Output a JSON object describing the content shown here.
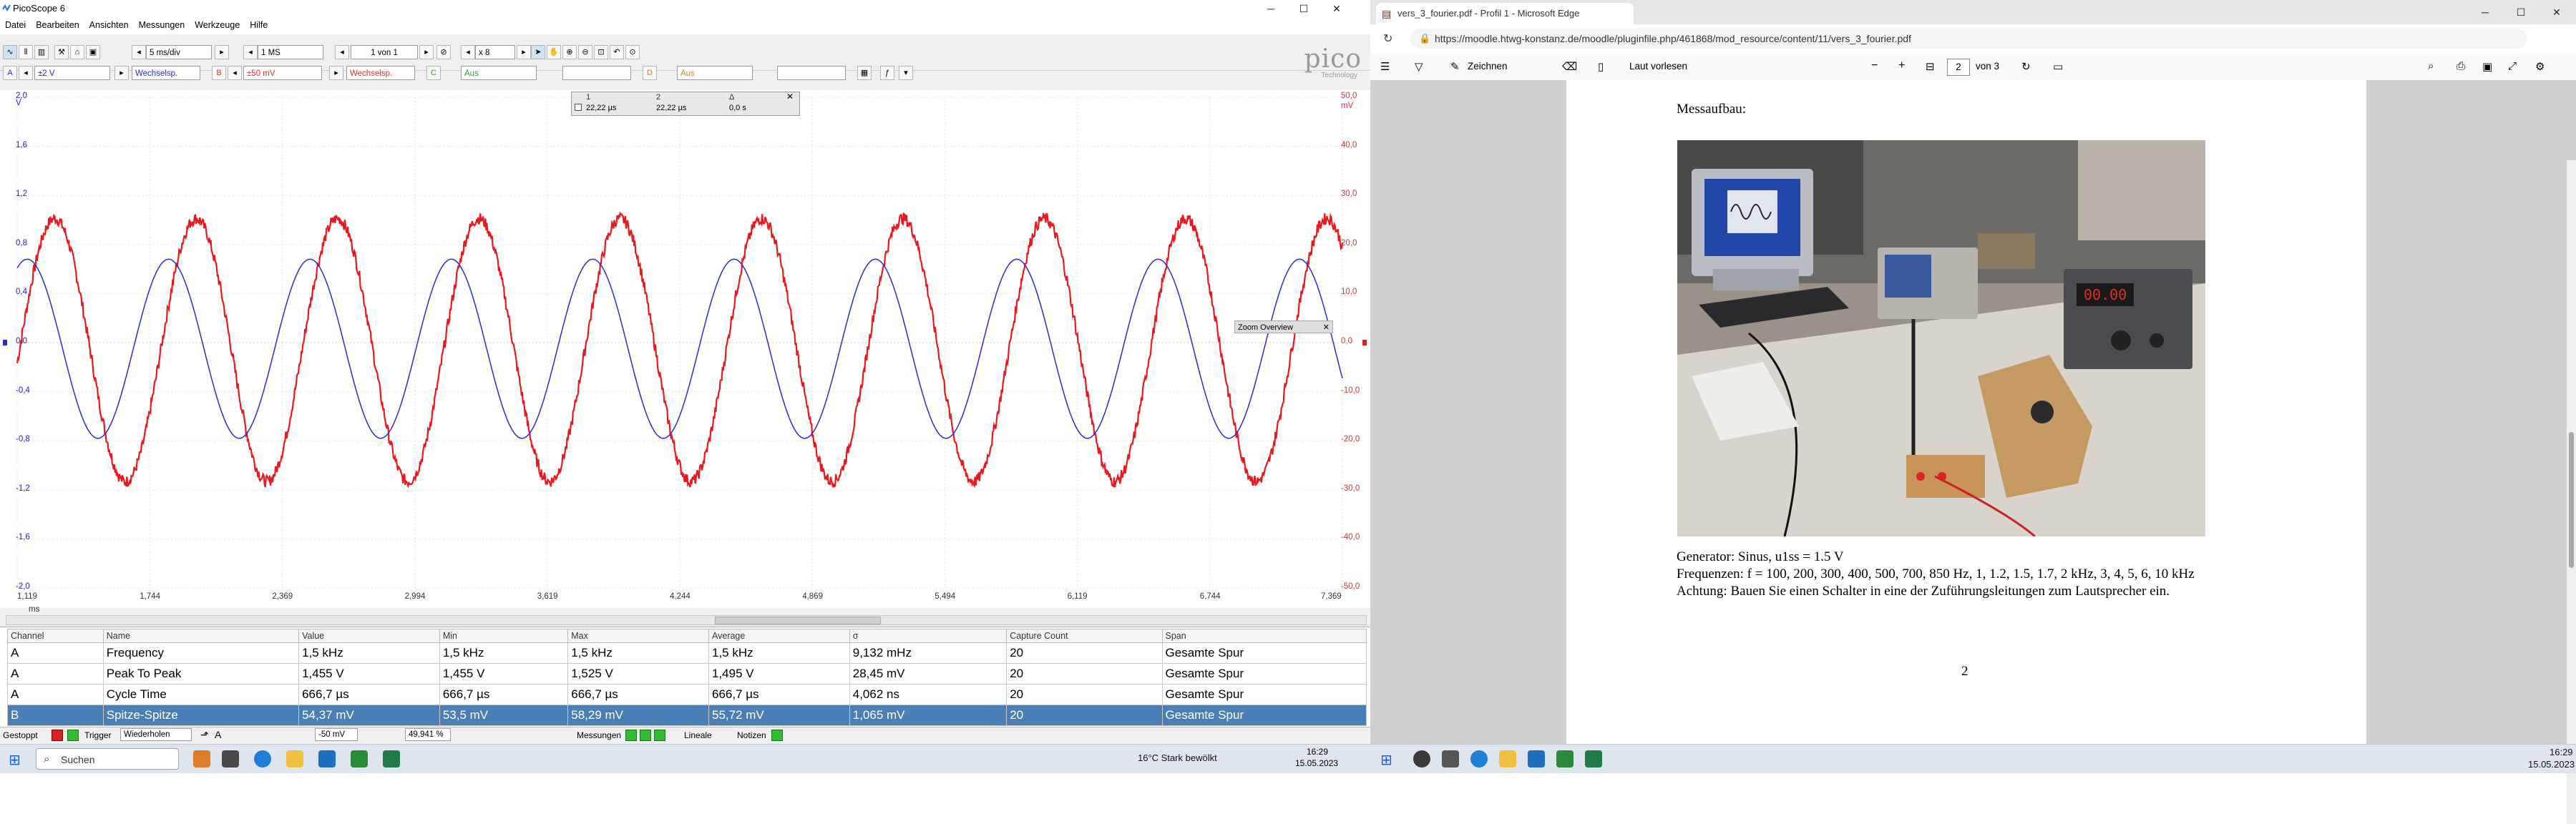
{
  "pico": {
    "title": "PicoScope 6",
    "menus": [
      "Datei",
      "Bearbeiten",
      "Ansichten",
      "Messungen",
      "Werkzeuge",
      "Hilfe"
    ],
    "toolbar": {
      "timebase": "5 ms/div",
      "samples": "1 MS",
      "capture_index": "1 von 1",
      "zoom": "x 8",
      "chA_range": "±2 V",
      "chA_coupling": "Wechselsp.",
      "chB_range": "±50 mV",
      "chB_coupling": "Wechselsp.",
      "chC_label": "Aus",
      "chD_label": "Aus"
    },
    "logo": "pico",
    "logo_sub": "Technology",
    "axes": {
      "left_unit": "V",
      "right_unit": "mV",
      "x_unit": "ms",
      "left_ticks": [
        "2,0",
        "1,6",
        "1,2",
        "0,8",
        "0,4",
        "0,0",
        "-0,4",
        "-0,8",
        "-1,2",
        "-1,6",
        "-2,0"
      ],
      "right_ticks": [
        "50,0",
        "40,0",
        "30,0",
        "20,0",
        "10,0",
        "0,0",
        "-10,0",
        "-20,0",
        "-30,0",
        "-40,0",
        "-50,0"
      ],
      "x_ticks": [
        "1,119",
        "1,744",
        "2,369",
        "2,994",
        "3,619",
        "4,244",
        "4,869",
        "5,494",
        "6,119",
        "6,744",
        "7,369"
      ]
    },
    "ruler_panel": {
      "c1": "22,22 µs",
      "c2": "22,22 µs",
      "c3": "0,0 s",
      "h1": "1",
      "h2": "2",
      "h3": "Δ"
    },
    "zoom_overview": "Zoom Overview",
    "measurements": {
      "headers": [
        "Channel",
        "Name",
        "Value",
        "Min",
        "Max",
        "Average",
        "σ",
        "Capture Count",
        "Span"
      ],
      "rows": [
        [
          "A",
          "Frequency",
          "1,5 kHz",
          "1,5 kHz",
          "1,5 kHz",
          "1,5 kHz",
          "9,132 mHz",
          "20",
          "Gesamte Spur"
        ],
        [
          "A",
          "Peak To Peak",
          "1,455 V",
          "1,455 V",
          "1,525 V",
          "1,495 V",
          "28,45 mV",
          "20",
          "Gesamte Spur"
        ],
        [
          "A",
          "Cycle Time",
          "666,7 µs",
          "666,7 µs",
          "666,7 µs",
          "666,7 µs",
          "4,062 ns",
          "20",
          "Gesamte Spur"
        ],
        [
          "B",
          "Spitze-Spitze",
          "54,37 mV",
          "53,5 mV",
          "58,29 mV",
          "55,72 mV",
          "1,065 mV",
          "20",
          "Gesamte Spur"
        ]
      ]
    },
    "status": {
      "state": "Gestoppt",
      "trigger_label": "Trigger",
      "trigger_mode": "Wiederholen",
      "trigger_level": "-50 mV",
      "trigger_pos": "49,941 %",
      "measurements": "Messungen",
      "rulers": "Lineale",
      "notes": "Notizen"
    },
    "signal": {
      "channel_a_color": "#2a2ad0",
      "channel_b_color": "#e8181e",
      "channel_a_amplitude_v": 0.73,
      "channel_a_offset_v": -0.05,
      "channel_b_amplitude_mv": 26.8,
      "channel_b_offset_mv": -1.5,
      "frequency_khz": 1.5,
      "x_start_ms": 1.119,
      "x_end_ms": 7.369,
      "channel_a_phase_deg": 180,
      "channel_b_phase_deg": 110
    }
  },
  "taskbar_left": {
    "search": "Suchen",
    "time": "16:29",
    "date": "15.05.2023"
  },
  "edge": {
    "tab_title": "vers_3_fourier.pdf - Profil 1 - Microsoft Edge",
    "url": "https://moodle.htwg-konstanz.de/moodle/pluginfile.php/461868/mod_resource/content/11/vers_3_fourier.pdf",
    "toolbar": {
      "draw": "Zeichnen",
      "read_aloud": "Laut vorlesen",
      "minus": "−",
      "plus": "+",
      "page": "2",
      "of_pages": "von 3"
    }
  },
  "pdf": {
    "heading": "Messaufbau:",
    "line1": "Generator: Sinus, u1ss = 1.5 V",
    "line2": "Frequenzen: f = 100, 200, 300, 400, 500, 700, 850 Hz, 1, 1.2, 1.5, 1.7, 2 kHz, 3, 4, 5, 6, 10 kHz",
    "line3": "Achtung: Bauen Sie einen Schalter in eine der Zuführungsleitungen zum Lautsprecher ein.",
    "page_number": "2"
  },
  "taskbar_right": {
    "weather": "16°C   Stark bewölkt",
    "time": "16:29",
    "date": "15.05.2023"
  }
}
